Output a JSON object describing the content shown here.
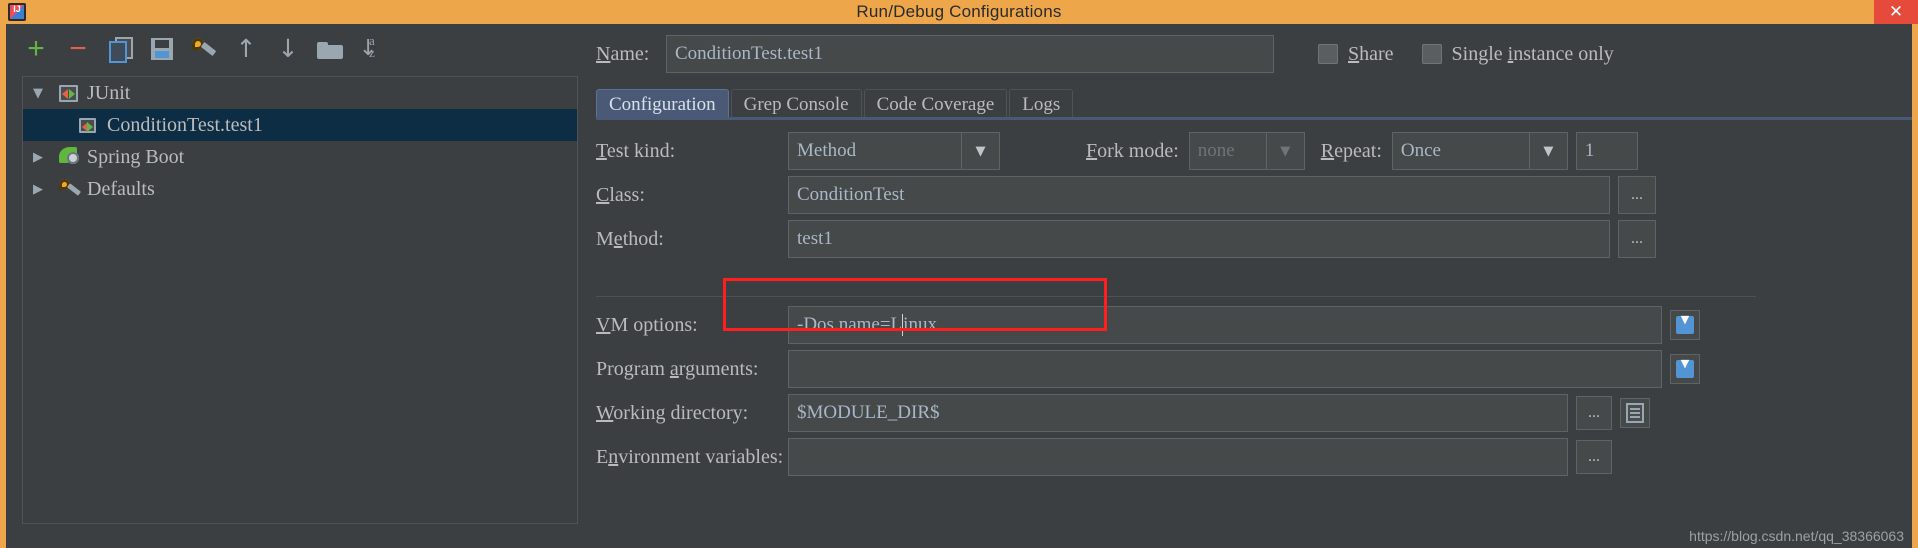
{
  "window": {
    "title": "Run/Debug Configurations",
    "app_icon": "intellij-idea-icon",
    "close_label": "✕",
    "title_bar_color": "#eda64a"
  },
  "toolbar": {
    "buttons": [
      {
        "name": "add-configuration-button",
        "icon": "plus-icon",
        "glyph": "+"
      },
      {
        "name": "remove-configuration-button",
        "icon": "minus-icon",
        "glyph": "−"
      },
      {
        "name": "copy-configuration-button",
        "icon": "copy-icon",
        "glyph": ""
      },
      {
        "name": "save-configuration-button",
        "icon": "save-icon",
        "glyph": ""
      },
      {
        "name": "edit-defaults-button",
        "icon": "wrench-icon",
        "glyph": ""
      },
      {
        "name": "move-up-button",
        "icon": "arrow-up-icon",
        "glyph": "↑"
      },
      {
        "name": "move-down-button",
        "icon": "arrow-down-icon",
        "glyph": "↓"
      },
      {
        "name": "create-folder-button",
        "icon": "folder-icon",
        "glyph": ""
      },
      {
        "name": "sort-configurations-button",
        "icon": "sort-az-icon",
        "glyph": "↓"
      }
    ]
  },
  "tree": {
    "items": [
      {
        "label": "JUnit",
        "icon": "junit-icon",
        "twisty": "▼",
        "expanded": true,
        "selected": false,
        "indent": false
      },
      {
        "label": "ConditionTest.test1",
        "icon": "junit-icon",
        "twisty": "",
        "expanded": false,
        "selected": true,
        "indent": true
      },
      {
        "label": "Spring Boot",
        "icon": "spring-boot-icon",
        "twisty": "▶",
        "expanded": false,
        "selected": false,
        "indent": false
      },
      {
        "label": "Defaults",
        "icon": "defaults-wrench-icon",
        "twisty": "▶",
        "expanded": false,
        "selected": false,
        "indent": false
      }
    ]
  },
  "header": {
    "name_label": "Name:",
    "name_mnemonic": "N",
    "name_label_rest": "ame:",
    "name_value": "ConditionTest.test1",
    "share_label_mnemonic": "S",
    "share_label_rest": "hare",
    "share_checked": false,
    "single_instance_prefix": "Single ",
    "single_instance_mnemonic": "i",
    "single_instance_rest": "nstance only",
    "single_instance_checked": false
  },
  "tabs": [
    {
      "label": "Configuration",
      "active": true
    },
    {
      "label": "Grep Console",
      "active": false
    },
    {
      "label": "Code Coverage",
      "active": false
    },
    {
      "label": "Logs",
      "active": false
    }
  ],
  "form": {
    "test_kind": {
      "label_mnemonic": "T",
      "label_rest": "est kind:",
      "value": "Method",
      "arrow": "▼"
    },
    "fork_mode": {
      "label_prefix": "F",
      "label_rest": "ork mode:",
      "value": "none",
      "arrow": "▼",
      "disabled": true
    },
    "repeat": {
      "label_mnemonic": "R",
      "label_rest": "epeat:",
      "value": "Once",
      "arrow": "▼",
      "count_value": "1"
    },
    "class_field": {
      "label_mnemonic": "C",
      "label_rest": "lass:",
      "value": "ConditionTest",
      "browse_label": "..."
    },
    "method_field": {
      "label_prefix": "M",
      "label_mnemonic": "e",
      "label_rest": "thod:",
      "value": "test1",
      "browse_label": "..."
    },
    "vm_options": {
      "label_mnemonic": "V",
      "label_rest": "M options:",
      "value": "-Dos.name=L",
      "value_after_caret": "inux",
      "expand_icon": "expand-editor-icon",
      "highlight_color": "#ff1f1f"
    },
    "program_arguments": {
      "label_prefix": "Program ",
      "label_mnemonic": "a",
      "label_rest": "rguments:",
      "value": "",
      "expand_icon": "expand-editor-icon"
    },
    "working_directory": {
      "label_mnemonic": "W",
      "label_rest": "orking directory:",
      "value": "$MODULE_DIR$",
      "browse_label": "...",
      "macros_icon": "macros-icon"
    },
    "environment_variables": {
      "label_prefix": "E",
      "label_mnemonic": "n",
      "label_rest": "vironment variables:",
      "value": "",
      "browse_label": "..."
    }
  },
  "watermark": "https://blog.csdn.net/qq_38366063"
}
